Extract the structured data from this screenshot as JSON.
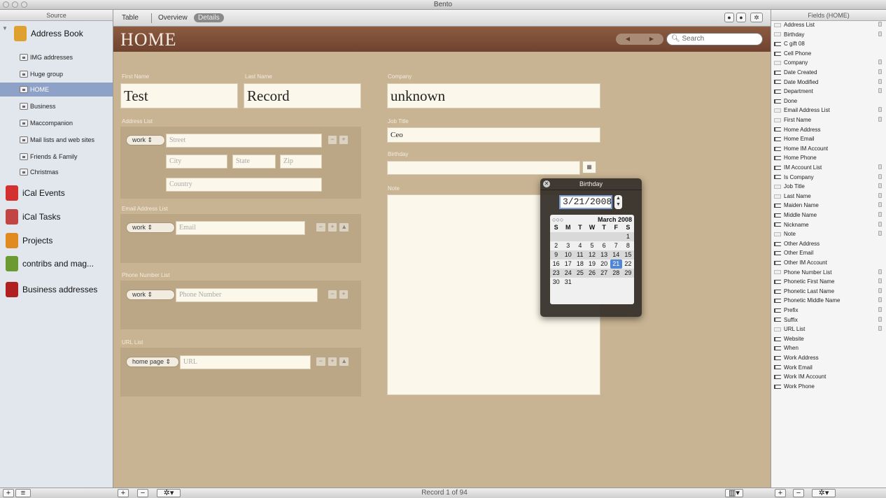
{
  "window_title": "Bento",
  "source": {
    "header": "Source",
    "items": [
      {
        "label": "Address Book",
        "kind": "library",
        "color": "#e0a030",
        "size": "big"
      },
      {
        "label": "IMG addresses",
        "kind": "group",
        "size": "small"
      },
      {
        "label": "Huge group",
        "kind": "group",
        "size": "small"
      },
      {
        "label": "HOME",
        "kind": "group",
        "size": "small",
        "selected": true
      },
      {
        "label": "Business",
        "kind": "group",
        "size": "small"
      },
      {
        "label": "Maccompanion",
        "kind": "group",
        "size": "small"
      },
      {
        "label": "Mail lists and web sites",
        "kind": "group",
        "size": "small"
      },
      {
        "label": "Friends & Family",
        "kind": "group",
        "size": "small"
      },
      {
        "label": "Christmas",
        "kind": "group",
        "size": "small"
      },
      {
        "label": "iCal Events",
        "kind": "library",
        "color": "#d33030",
        "size": "big"
      },
      {
        "label": "iCal Tasks",
        "kind": "library",
        "color": "#c24545",
        "size": "big"
      },
      {
        "label": "Projects",
        "kind": "library",
        "color": "#e08a20",
        "size": "big"
      },
      {
        "label": "contribs and mag...",
        "kind": "library",
        "color": "#6a9a30",
        "size": "big"
      },
      {
        "label": "Business addresses",
        "kind": "library",
        "color": "#b02020",
        "size": "big"
      }
    ]
  },
  "tabs": {
    "table": "Table",
    "overview": "Overview",
    "details": "Details"
  },
  "header": {
    "title": "HOME",
    "prev": "◀",
    "next": "▶",
    "search_placeholder": "Search"
  },
  "form": {
    "first_name": {
      "label": "First Name",
      "value": "Test"
    },
    "last_name": {
      "label": "Last Name",
      "value": "Record"
    },
    "company": {
      "label": "Company",
      "value": "unknown"
    },
    "address_list": {
      "label": "Address List",
      "type": "work",
      "street": "Street",
      "city": "City",
      "state": "State",
      "zip": "Zip",
      "country": "Country"
    },
    "email_list": {
      "label": "Email Address List",
      "type": "work",
      "placeholder": "Email"
    },
    "phone_list": {
      "label": "Phone Number List",
      "type": "work",
      "placeholder": "Phone Number"
    },
    "url_list": {
      "label": "URL List",
      "type": "home page",
      "placeholder": "URL"
    },
    "job_title": {
      "label": "Job Title",
      "value": "Ceo"
    },
    "birthday": {
      "label": "Birthday",
      "value": ""
    },
    "note": {
      "label": "Note"
    }
  },
  "birthday_popup": {
    "title": "Birthday",
    "date_value": "3/21/2008",
    "month_label": "March 2008",
    "weekdays": [
      "S",
      "M",
      "T",
      "W",
      "T",
      "F",
      "S"
    ],
    "weeks": [
      [
        "",
        "",
        "",
        "",
        "",
        "",
        "1"
      ],
      [
        "2",
        "3",
        "4",
        "5",
        "6",
        "7",
        "8"
      ],
      [
        "9",
        "10",
        "11",
        "12",
        "13",
        "14",
        "15"
      ],
      [
        "16",
        "17",
        "18",
        "19",
        "20",
        "21",
        "22"
      ],
      [
        "23",
        "24",
        "25",
        "26",
        "27",
        "28",
        "29"
      ],
      [
        "30",
        "31",
        "",
        "",
        "",
        "",
        ""
      ]
    ],
    "selected_day": "21"
  },
  "fields_pane": {
    "header": "Fields (HOME)",
    "items": [
      {
        "label": "Address List",
        "on": false,
        "lock": true
      },
      {
        "label": "Birthday",
        "on": false,
        "lock": true
      },
      {
        "label": "C gift 08",
        "on": true,
        "lock": false
      },
      {
        "label": "Cell Phone",
        "on": true,
        "lock": false
      },
      {
        "label": "Company",
        "on": false,
        "lock": true
      },
      {
        "label": "Date Created",
        "on": true,
        "lock": true
      },
      {
        "label": "Date Modified",
        "on": true,
        "lock": true
      },
      {
        "label": "Department",
        "on": true,
        "lock": true
      },
      {
        "label": "Done",
        "on": true,
        "lock": false
      },
      {
        "label": "Email Address List",
        "on": false,
        "lock": true
      },
      {
        "label": "First Name",
        "on": false,
        "lock": true
      },
      {
        "label": "Home Address",
        "on": true,
        "lock": false
      },
      {
        "label": "Home Email",
        "on": true,
        "lock": false
      },
      {
        "label": "Home IM Account",
        "on": true,
        "lock": false
      },
      {
        "label": "Home Phone",
        "on": true,
        "lock": false
      },
      {
        "label": "IM Account List",
        "on": true,
        "lock": true
      },
      {
        "label": "Is Company",
        "on": true,
        "lock": true
      },
      {
        "label": "Job Title",
        "on": false,
        "lock": true
      },
      {
        "label": "Last Name",
        "on": false,
        "lock": true
      },
      {
        "label": "Maiden Name",
        "on": true,
        "lock": true
      },
      {
        "label": "Middle Name",
        "on": true,
        "lock": true
      },
      {
        "label": "Nickname",
        "on": true,
        "lock": true
      },
      {
        "label": "Note",
        "on": false,
        "lock": true
      },
      {
        "label": "Other Address",
        "on": true,
        "lock": false
      },
      {
        "label": "Other Email",
        "on": true,
        "lock": false
      },
      {
        "label": "Other IM Account",
        "on": true,
        "lock": false
      },
      {
        "label": "Phone Number List",
        "on": false,
        "lock": true
      },
      {
        "label": "Phonetic First Name",
        "on": true,
        "lock": true
      },
      {
        "label": "Phonetic Last Name",
        "on": true,
        "lock": true
      },
      {
        "label": "Phonetic Middle Name",
        "on": true,
        "lock": true
      },
      {
        "label": "Prefix",
        "on": true,
        "lock": true
      },
      {
        "label": "Suffix",
        "on": true,
        "lock": true
      },
      {
        "label": "URL List",
        "on": false,
        "lock": true
      },
      {
        "label": "Website",
        "on": true,
        "lock": false
      },
      {
        "label": "When",
        "on": true,
        "lock": false
      },
      {
        "label": "Work Address",
        "on": true,
        "lock": false
      },
      {
        "label": "Work Email",
        "on": true,
        "lock": false
      },
      {
        "label": "Work IM Account",
        "on": true,
        "lock": false
      },
      {
        "label": "Work Phone",
        "on": true,
        "lock": false
      }
    ]
  },
  "footer": {
    "record": "Record 1 of 94"
  }
}
